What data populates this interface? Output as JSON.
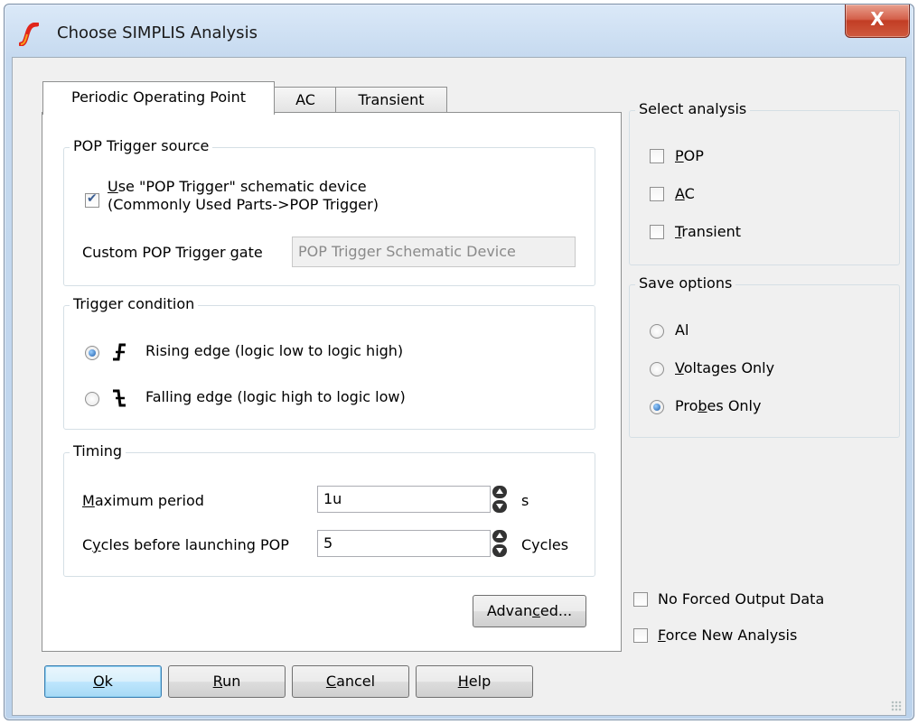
{
  "window": {
    "title": "Choose SIMPLIS Analysis",
    "close_label": "X"
  },
  "tabs": [
    {
      "label": "Periodic Operating Point",
      "active": true
    },
    {
      "label": "AC",
      "active": false
    },
    {
      "label": "Transient",
      "active": false
    }
  ],
  "pop_trigger": {
    "title": "POP Trigger source",
    "use_device": {
      "checked": true,
      "line1_prefix": "U",
      "line1_rest": "se \"POP Trigger\" schematic device",
      "line2": "(Commonly Used Parts->POP Trigger)"
    },
    "gate_label_prefix": "Custom POP Trigger ",
    "gate_label_u": "g",
    "gate_label_suffix": "ate",
    "gate_value": "POP Trigger Schematic Device"
  },
  "trigger_condition": {
    "title": "Trigger condition",
    "rising": {
      "label": "Rising edge (logic low to logic high)",
      "selected": true
    },
    "falling": {
      "label": "Falling edge (logic high to logic low)",
      "selected": false
    }
  },
  "timing": {
    "title": "Timing",
    "max_period": {
      "label_u": "M",
      "label_rest": "aximum period",
      "value": "1u",
      "unit": "s"
    },
    "cycles": {
      "label_prefix": "C",
      "label_u": "y",
      "label_rest": "cles before launching POP",
      "value": "5",
      "unit": "Cycles"
    }
  },
  "advanced_button": {
    "prefix": "Advan",
    "u": "c",
    "suffix": "ed..."
  },
  "select_analysis": {
    "title": "Select analysis",
    "pop": {
      "u": "P",
      "rest": "OP",
      "checked": false
    },
    "ac": {
      "u": "A",
      "rest": "C",
      "checked": false
    },
    "transient": {
      "u": "T",
      "rest": "ransient",
      "checked": false
    }
  },
  "save_options": {
    "title": "Save options",
    "all": {
      "prefix": "Al",
      "u": "l",
      "rest": "",
      "selected": false
    },
    "voltages": {
      "prefix": "",
      "u": "V",
      "rest": "oltages Only",
      "selected": false
    },
    "probes": {
      "prefix": "Pro",
      "u": "b",
      "rest": "es Only",
      "selected": true
    }
  },
  "options": {
    "no_forced": {
      "label": "No Forced Output Data",
      "checked": false
    },
    "force_new": {
      "u": "F",
      "rest": "orce New Analysis",
      "checked": false
    }
  },
  "buttons": {
    "ok": {
      "u": "O",
      "rest": "k"
    },
    "run": {
      "u": "R",
      "rest": "un"
    },
    "cancel": {
      "u": "C",
      "rest": "ancel"
    },
    "help": {
      "u": "H",
      "rest": "elp"
    }
  },
  "colors": {
    "accent": "#3c7fb1",
    "close": "#c23d24",
    "logo": "#e1251b"
  }
}
